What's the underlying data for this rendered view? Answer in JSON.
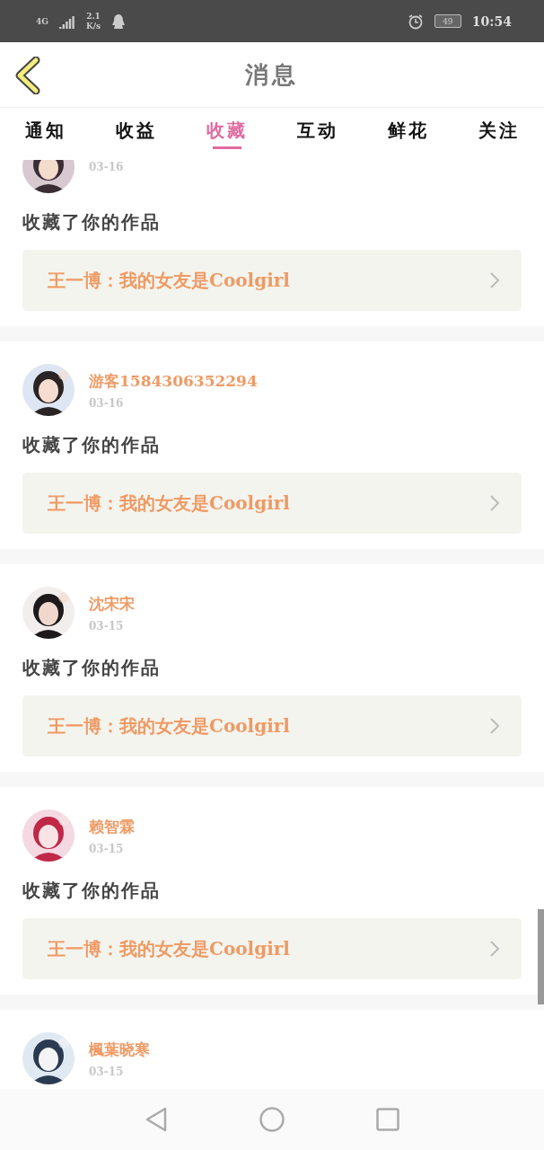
{
  "status_bar": {
    "network": "4G",
    "speed_value": "2.1",
    "speed_unit": "K/s",
    "battery": "49",
    "time": "10:54"
  },
  "header": {
    "title": "消息"
  },
  "tabs": [
    {
      "label": "通知",
      "selected": false
    },
    {
      "label": "收益",
      "selected": false
    },
    {
      "label": "收藏",
      "selected": true
    },
    {
      "label": "互动",
      "selected": false
    },
    {
      "label": "鲜花",
      "selected": false
    },
    {
      "label": "关注",
      "selected": false
    }
  ],
  "messages": [
    {
      "date": "03-16",
      "action": "收藏了你的作品",
      "work": "王一博：我的女友是Coolgirl"
    },
    {
      "name": "游客1584306352294",
      "date": "03-16",
      "action": "收藏了你的作品",
      "work": "王一博：我的女友是Coolgirl"
    },
    {
      "name": "沈宋宋",
      "date": "03-15",
      "action": "收藏了你的作品",
      "work": "王一博：我的女友是Coolgirl"
    },
    {
      "name": "赖智霖",
      "date": "03-15",
      "action": "收藏了你的作品",
      "work": "王一博：我的女友是Coolgirl"
    },
    {
      "name": "楓葉晓寒",
      "date": "03-15"
    }
  ]
}
